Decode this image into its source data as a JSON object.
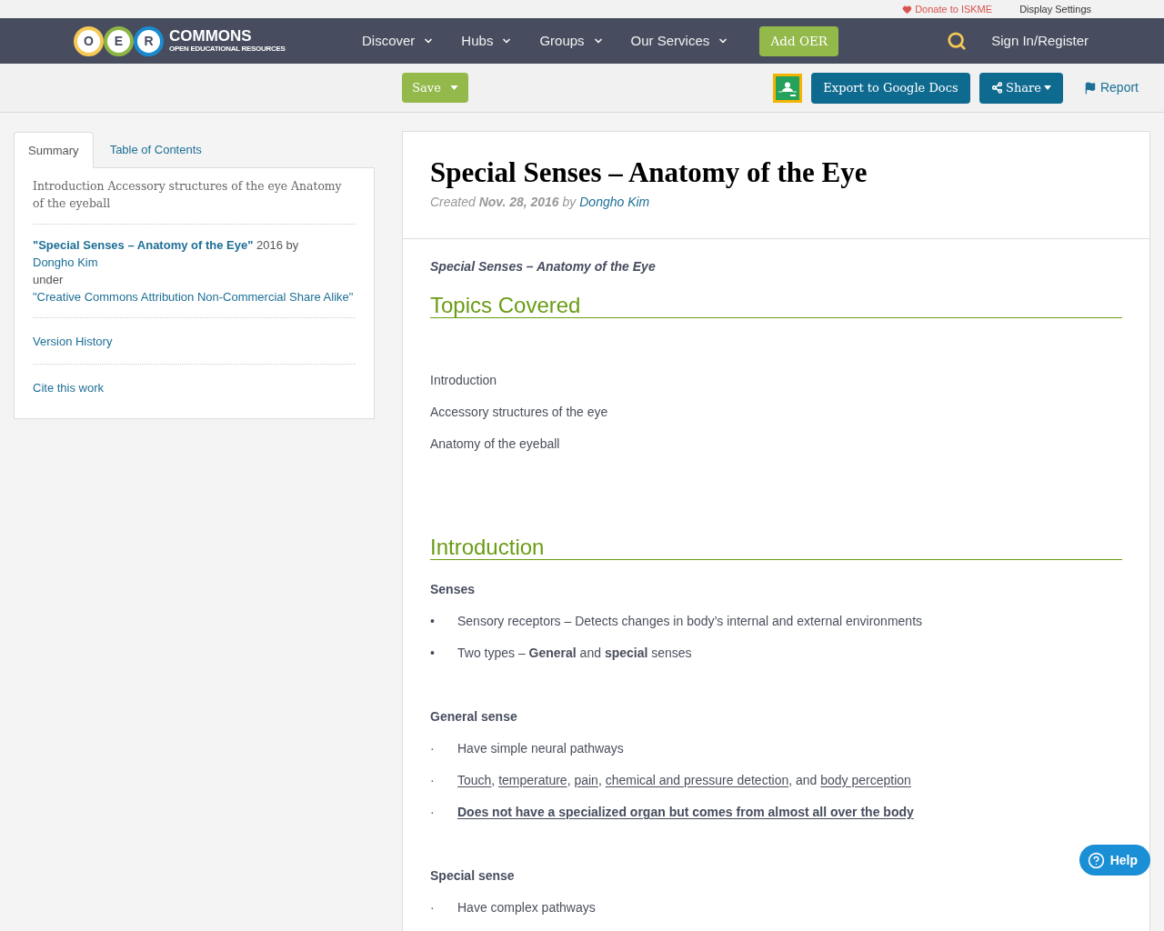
{
  "top_bar": {
    "donate": "Donate to ISKME",
    "display_settings": "Display Settings"
  },
  "nav": {
    "logo": {
      "letters": [
        {
          "text": "O",
          "color": "#f6c855"
        },
        {
          "text": "E",
          "color": "#8db544"
        },
        {
          "text": "R",
          "color": "#1b8bd0"
        }
      ],
      "wordmark": "COMMONS",
      "tagline": "OPEN EDUCATIONAL RESOURCES"
    },
    "menu": [
      {
        "label": "Discover"
      },
      {
        "label": "Hubs"
      },
      {
        "label": "Groups"
      },
      {
        "label": "Our Services"
      }
    ],
    "add_button": "Add OER",
    "sign_in": "Sign In/Register"
  },
  "toolbar": {
    "save": "Save",
    "export": "Export to Google Docs",
    "share": "Share",
    "report": "Report"
  },
  "sidebar": {
    "tabs": [
      {
        "label": "Summary",
        "selected": true
      },
      {
        "label": "Table of Contents",
        "selected": false
      }
    ],
    "summary": "Introduction Accessory structures of the eye Anatomy of the eyeball",
    "attribution": {
      "title": "\"Special Senses – Anatomy of the Eye\"",
      "text": "2016 by",
      "author": "Dongho Kim",
      "under": "under",
      "license": "\"Creative Commons Attribution Non-Commercial Share Alike\""
    },
    "links": [
      "Version History",
      "Cite this work"
    ]
  },
  "resource": {
    "title": "Special Senses – Anatomy of the Eye",
    "created": {
      "text": "Created **Nov. 28, 2016** by",
      "author": "Dongho Kim"
    },
    "body": [
      {
        "kind": "lead",
        "text": "Special Senses – Anatomy of the Eye"
      },
      {
        "kind": "heading",
        "text": "Topics Covered"
      },
      {
        "kind": "plain_list",
        "items": [
          "Introduction",
          "Accessory structures of the eye",
          "Anatomy of the eyeball"
        ]
      },
      {
        "kind": "heading",
        "text": "Introduction"
      },
      {
        "kind": "subheading",
        "text": "Senses"
      },
      {
        "kind": "bullets",
        "marker": "•",
        "items": [
          {
            "bold": false,
            "parts": [
              {
                "text": "Sensory receptors – Detects changes in body’s internal and external environments",
                "underlined": false
              }
            ]
          },
          {
            "bold": false,
            "parts": [
              {
                "text": "Two types – **General** and **special** senses",
                "underlined": false
              }
            ]
          }
        ]
      },
      {
        "kind": "subheading",
        "text": "General sense"
      },
      {
        "kind": "bullets",
        "marker": "·",
        "items": [
          {
            "bold": false,
            "parts": [
              {
                "text": "Have simple neural pathways",
                "underlined": false
              }
            ]
          },
          {
            "bold": false,
            "parts": [
              {
                "text": "Touch",
                "underlined": true
              },
              {
                "text": ", ",
                "underlined": false
              },
              {
                "text": "temperature",
                "underlined": true
              },
              {
                "text": ", ",
                "underlined": false
              },
              {
                "text": "pain",
                "underlined": true
              },
              {
                "text": ", ",
                "underlined": false
              },
              {
                "text": "chemical and pressure detection",
                "underlined": true
              },
              {
                "text": ", and ",
                "underlined": false
              },
              {
                "text": "body perception",
                "underlined": true
              }
            ]
          },
          {
            "bold": true,
            "parts": [
              {
                "text": "Does not have a specialized organ but comes from almost all over the body",
                "underlined": true
              }
            ]
          }
        ]
      },
      {
        "kind": "subheading",
        "text": "Special sense"
      },
      {
        "kind": "bullets",
        "marker": "·",
        "items": [
          {
            "bold": false,
            "parts": [
              {
                "text": "Have complex pathways",
                "underlined": false
              }
            ]
          }
        ]
      }
    ]
  },
  "help_button": "Help"
}
